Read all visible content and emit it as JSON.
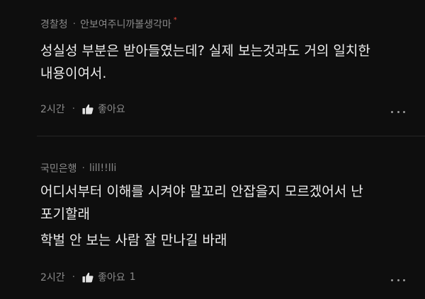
{
  "comments": [
    {
      "author": "경찰청",
      "meta_dot": "·",
      "subtitle": "안보여주니까볼생각마",
      "badge": "*",
      "lines": [
        "성실성 부분은 받아들였는데? 실제 보는것과도 거의 일치한",
        "내용이여서."
      ],
      "time": "2시간",
      "action_dot": "·",
      "like_label": "좋아요",
      "like_count": ""
    },
    {
      "author": "국민은행",
      "meta_dot": "·",
      "subtitle": "lill!!lli",
      "lines": [
        "어디서부터 이해를 시켜야 말꼬리 안잡을지 모르겠어서 난",
        "포기할래",
        "학벌 안 보는 사람 잘 만나길 바래"
      ],
      "time": "2시간",
      "action_dot": "·",
      "like_label": "좋아요",
      "like_count": "1"
    }
  ],
  "icons": {
    "like": "thumbs-up-icon",
    "more": "more-options-icon"
  },
  "colors": {
    "background": "#0e0e0e",
    "text": "#ededed",
    "muted": "#8a8a8a",
    "badge": "#e0453a"
  }
}
